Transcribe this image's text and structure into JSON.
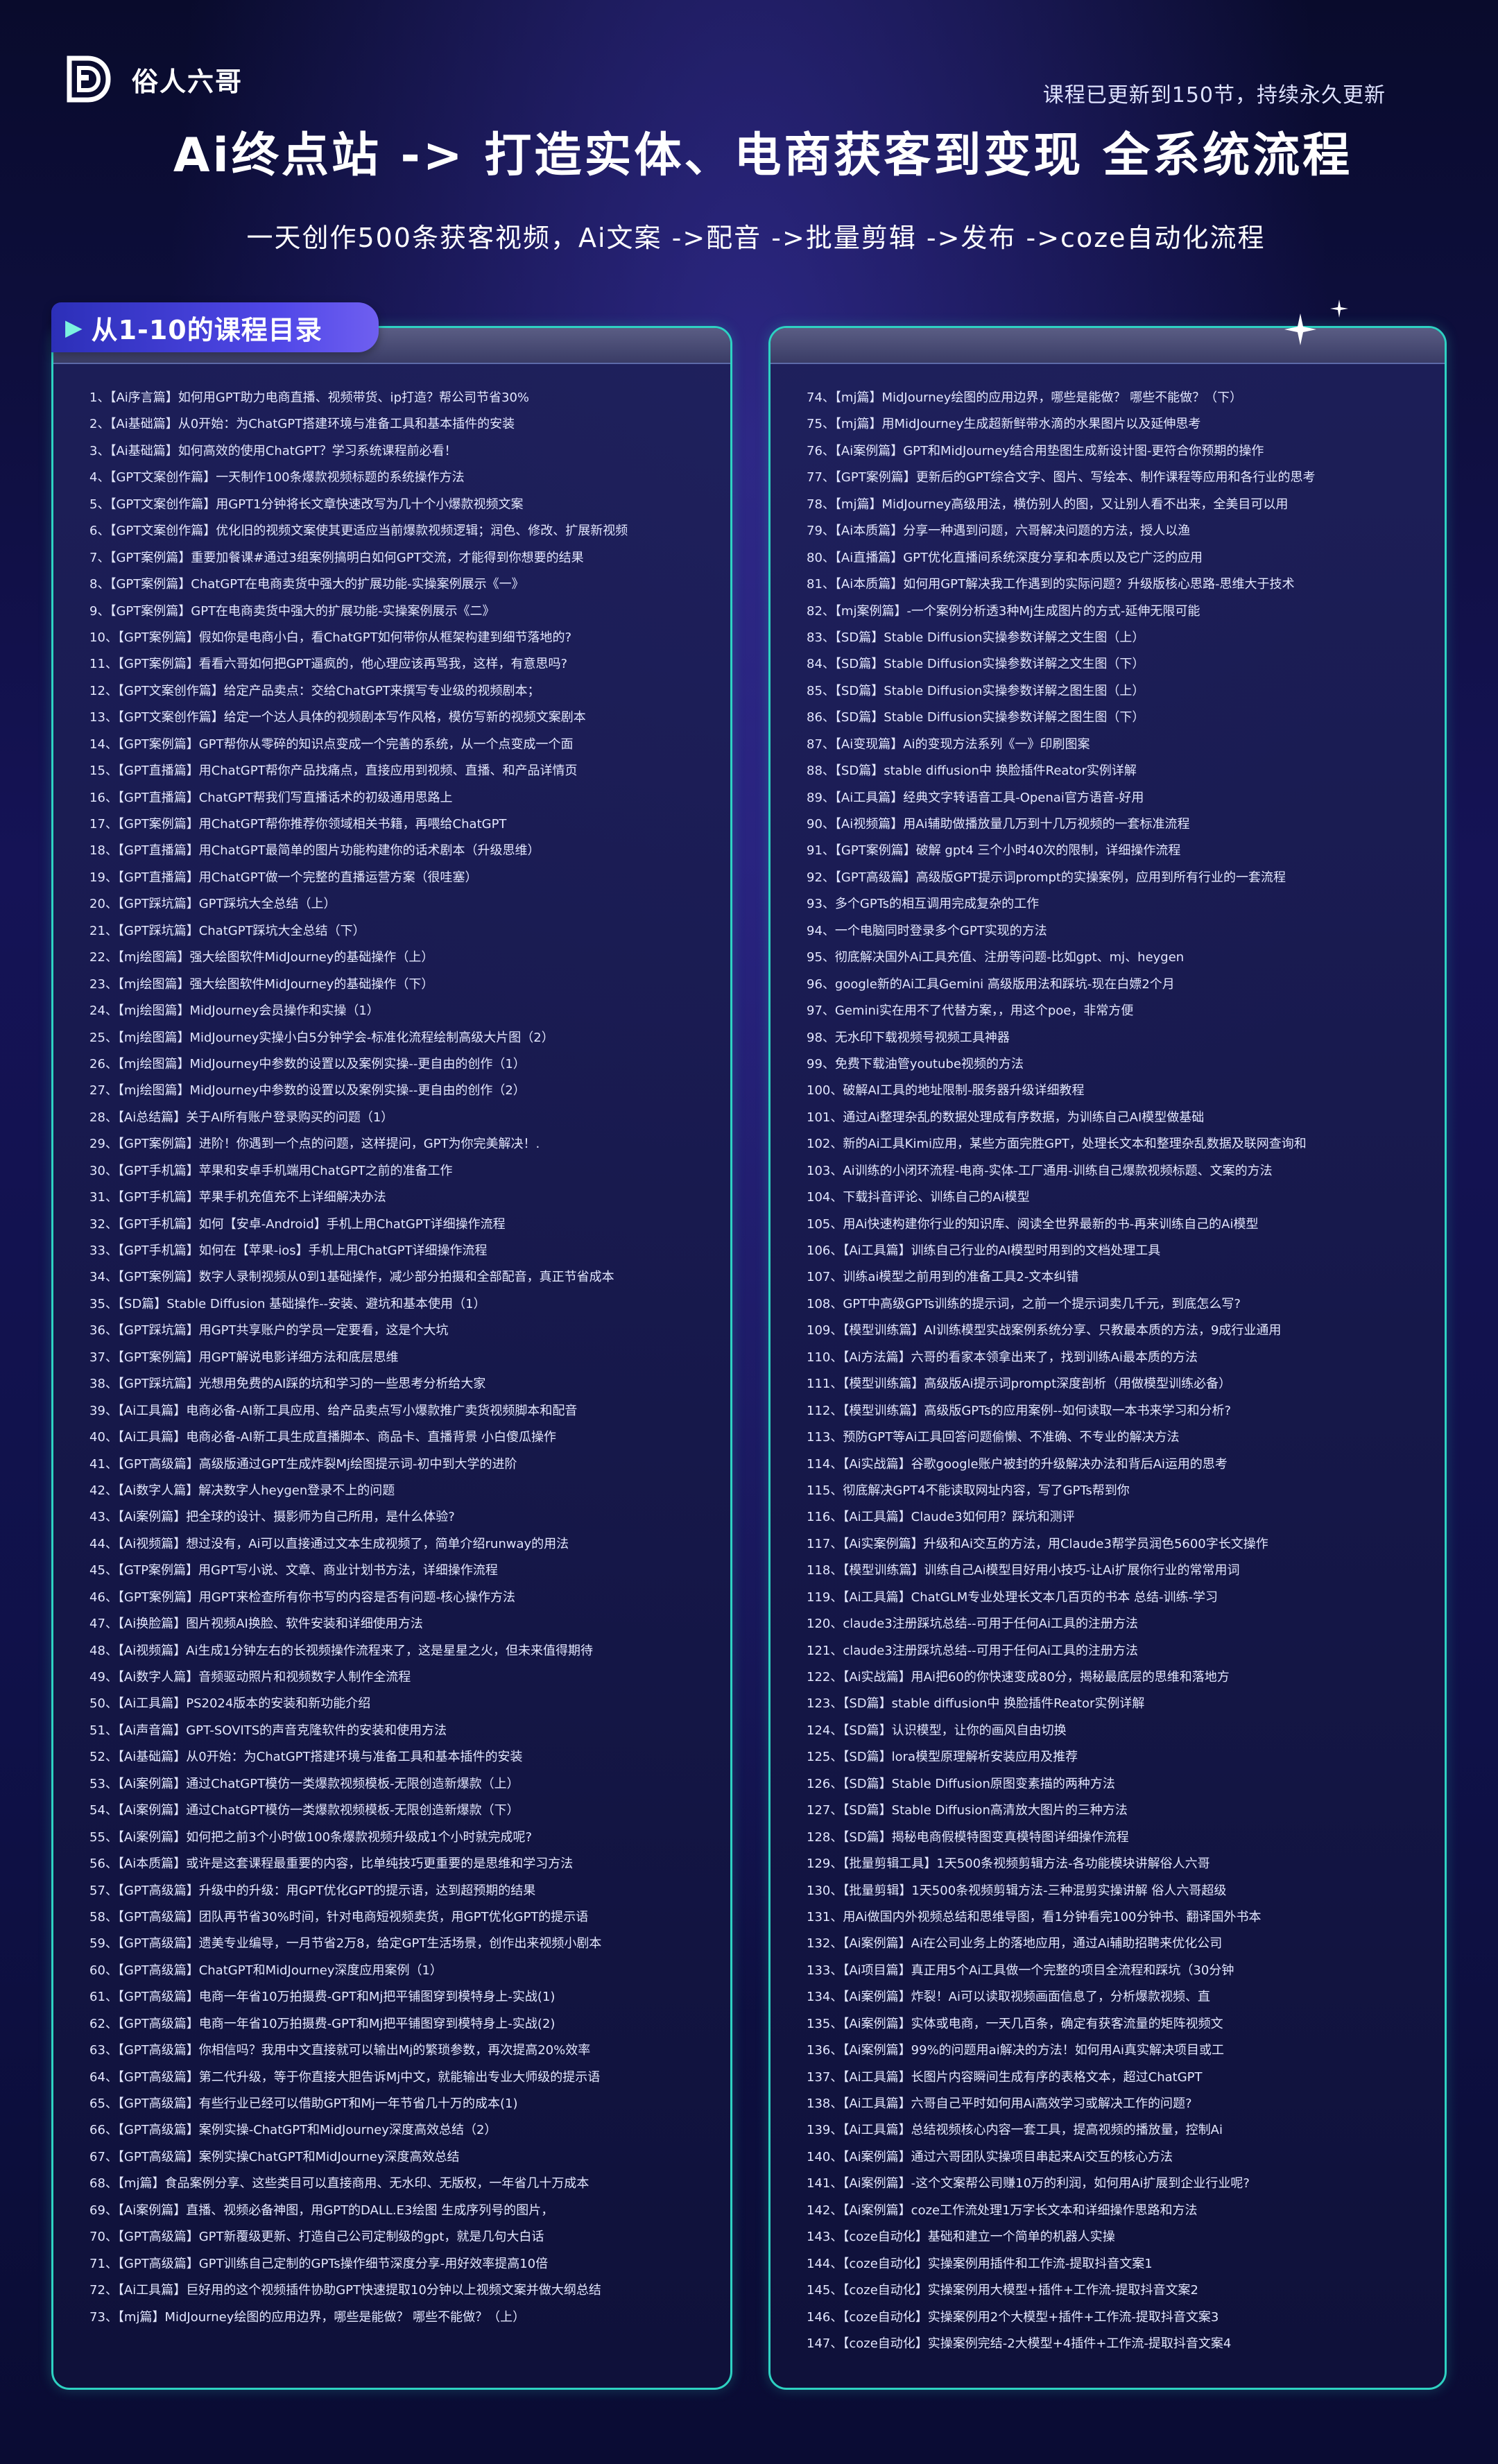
{
  "brand": {
    "name": "俗人六哥"
  },
  "header": {
    "update_note": "课程已更新到150节，持续永久更新",
    "title": "Ai终点站 -> 打造实体、电商获客到变现 全系统流程",
    "subtitle": "一天创作500条获客视频，Ai文案 ->配音 ->批量剪辑 ->发布 ->coze自动化流程"
  },
  "catalog": {
    "label": "从1-10的课程目录",
    "left": [
      "1、【Ai序言篇】如何用GPT助力电商直播、视频带货、ip打造？帮公司节省30%",
      "2、【Ai基础篇】从0开始：为ChatGPT搭建环境与准备工具和基本插件的安装",
      "3、【Ai基础篇】如何高效的使用ChatGPT？学习系统课程前必看！",
      "4、【GPT文案创作篇】一天制作100条爆款视频标题的系统操作方法",
      "5、【GPT文案创作篇】用GPT1分钟将长文章快速改写为几十个小爆款视频文案",
      "6、【GPT文案创作篇】优化旧的视频文案使其更适应当前爆款视频逻辑；润色、修改、扩展新视频",
      "7、【GPT案例篇】重要加餐课#通过3组案例搞明白如何GPT交流，才能得到你想要的结果",
      "8、【GPT案例篇】ChatGPT在电商卖货中强大的扩展功能-实操案例展示《一》",
      "9、【GPT案例篇】GPT在电商卖货中强大的扩展功能-实操案例展示《二》",
      "10、【GPT案例篇】假如你是电商小白，看ChatGPT如何带你从框架构建到细节落地的?",
      "11、【GPT案例篇】看看六哥如何把GPT逼疯的，他心理应该再骂我，这样，有意思吗?",
      "12、【GPT文案创作篇】给定产品卖点：交给ChatGPT来撰写专业级的视频剧本；",
      "13、【GPT文案创作篇】给定一个达人具体的视频剧本写作风格，模仿写新的视频文案剧本",
      "14、【GPT案例篇】GPT帮你从零碎的知识点变成一个完善的系统，从一个点变成一个面",
      "15、【GPT直播篇】用ChatGPT帮你产品找痛点，直接应用到视频、直播、和产品详情页",
      "16、【GPT直播篇】ChatGPT帮我们写直播话术的初级通用思路上",
      "17、【GPT案例篇】用ChatGPT帮你推荐你领域相关书籍，再喂给ChatGPT",
      "18、【GPT直播篇】用ChatGPT最简单的图片功能构建你的话术剧本（升级思维）",
      "19、【GPT直播篇】用ChatGPT做一个完整的直播运营方案（很哇塞）",
      "20、【GPT踩坑篇】GPT踩坑大全总结（上）",
      "21、【GPT踩坑篇】ChatGPT踩坑大全总结（下）",
      "22、【mj绘图篇】强大绘图软件MidJourney的基础操作（上）",
      "23、【mj绘图篇】强大绘图软件MidJourney的基础操作（下）",
      "24、【mj绘图篇】MidJourney会员操作和实操（1）",
      "25、【mj绘图篇】MidJourney实操小白5分钟学会-标准化流程绘制高级大片图（2）",
      "26、【mj绘图篇】MidJourney中参数的设置以及案例实操--更自由的创作（1）",
      "27、【mj绘图篇】MidJourney中参数的设置以及案例实操--更自由的创作（2）",
      "28、【Ai总结篇】关于AI所有账户登录购买的问题（1）",
      "29、【GPT案例篇】进阶！你遇到一个点的问题，这样提问，GPT为你完美解决！.",
      "30、【GPT手机篇】苹果和安卓手机端用ChatGPT之前的准备工作",
      "31、【GPT手机篇】苹果手机充值充不上详细解决办法",
      "32、【GPT手机篇】如何【安卓-Android】手机上用ChatGPT详细操作流程",
      "33、【GPT手机篇】如何在【苹果-ios】手机上用ChatGPT详细操作流程",
      "34、【GPT案例篇】数字人录制视频从0到1基础操作，减少部分拍摄和全部配音，真正节省成本",
      "35、【SD篇】Stable Diffusion 基础操作--安装、避坑和基本使用（1）",
      "36、【GPT踩坑篇】用GPT共享账户的学员一定要看，这是个大坑",
      "37、【GPT案例篇】用GPT解说电影详细方法和底层思维",
      "38、【GPT踩坑篇】光想用免费的AI踩的坑和学习的一些思考分析给大家",
      "39、【Ai工具篇】电商必备-AI新工具应用、给产品卖点写小爆款推广卖货视频脚本和配音",
      "40、【Ai工具篇】电商必备-AI新工具生成直播脚本、商品卡、直播背景 小白傻瓜操作",
      "41、【GPT高级篇】高级版通过GPT生成炸裂Mj绘图提示词-初中到大学的进阶",
      "42、【Ai数字人篇】解决数字人heygen登录不上的问题",
      "43、【Ai案例篇】把全球的设计、摄影师为自己所用，是什么体验?",
      "44、【Ai视频篇】想过没有，Ai可以直接通过文本生成视频了，简单介绍runway的用法",
      "45、【GTP案例篇】用GPT写小说、文章、商业计划书方法，详细操作流程",
      "46、【GPT案例篇】用GPT来检查所有你书写的内容是否有问题-核心操作方法",
      "47、【Ai换脸篇】图片视频AI换脸、软件安装和详细使用方法",
      "48、【Ai视频篇】Ai生成1分钟左右的长视频操作流程来了，这是星星之火，但未来值得期待",
      "49、【Ai数字人篇】音频驱动照片和视频数字人制作全流程",
      "50、【Ai工具篇】PS2024版本的安装和新功能介绍",
      "51、【Ai声音篇】GPT-SOVITS的声音克隆软件的安装和使用方法",
      "52、【Ai基础篇】从0开始：为ChatGPT搭建环境与准备工具和基本插件的安装",
      "53、【Ai案例篇】通过ChatGPT模仿一类爆款视频模板-无限创造新爆款（上）",
      "54、【Ai案例篇】通过ChatGPT模仿一类爆款视频模板-无限创造新爆款（下）",
      "55、【Ai案例篇】如何把之前3个小时做100条爆款视频升级成1个小时就完成呢?",
      "56、【Ai本质篇】或许是这套课程最重要的内容，比单纯技巧更重要的是思维和学习方法",
      "57、【GPT高级篇】升级中的升级：用GPT优化GPT的提示语，达到超预期的结果",
      "58、【GPT高级篇】团队再节省30%时间，针对电商短视频卖货，用GPT优化GPT的提示语",
      "59、【GPT高级篇】遗美专业编导，一月节省2万8，给定GPT生活场景，创作出来视频小剧本",
      "60、【GPT高级篇】ChatGPT和MidJourney深度应用案例（1）",
      "61、【GPT高级篇】电商一年省10万拍摄费-GPT和Mj把平铺图穿到模特身上-实战(1)",
      "62、【GPT高级篇】电商一年省10万拍摄费-GPT和Mj把平铺图穿到模特身上-实战(2)",
      "63、【GPT高级篇】你相信吗？我用中文直接就可以输出Mj的繁琐参数，再次提高20%效率",
      "64、【GPT高级篇】第二代升级，等于你直接大胆告诉Mj中文，就能输出专业大师级的提示语",
      "65、【GPT高级篇】有些行业已经可以借助GPT和Mj一年节省几十万的成本(1)",
      "66、【GPT高级篇】案例实操-ChatGPT和MidJourney深度高效总结（2）",
      "67、【GPT高级篇】案例实操ChatGPT和MidJourney深度高效总结",
      "68、【mj篇】食品案例分享、这些类目可以直接商用、无水印、无版权，一年省几十万成本",
      "69、【Ai案例篇】直播、视频必备神图，用GPT的DALL.E3绘图 生成序列号的图片，",
      "70、【GPT高级篇】GPT新覆级更新、打造自己公司定制级的gpt，就是几句大白话",
      "71、【GPT高级篇】GPT训练自己定制的GPTs操作细节深度分享-用好效率提高10倍",
      "72、【Ai工具篇】巨好用的这个视频插件协助GPT快速提取10分钟以上视频文案并做大纲总结",
      "73、【mj篇】MidJourney绘图的应用边界，哪些是能做？ 哪些不能做？（上）"
    ],
    "right": [
      "74、【mj篇】MidJourney绘图的应用边界，哪些是能做？ 哪些不能做？（下）",
      "75、【mj篇】用MidJourney生成超新鲜带水滴的水果图片以及延伸思考",
      "76、【Ai案例篇】GPT和MidJourney结合用垫图生成新设计图-更符合你预期的操作",
      "77、【GPT案例篇】更新后的GPT综合文字、图片、写绘本、制作课程等应用和各行业的思考",
      "78、【mj篇】MidJourney高级用法，横仿别人的图，又让别人看不出来，全美目可以用",
      "79、【Ai本质篇】分享一种遇到问题，六哥解决问题的方法，授人以渔",
      "80、【Ai直播篇】GPT优化直播间系统深度分享和本质以及它广泛的应用",
      "81、【Ai本质篇】如何用GPT解决我工作遇到的实际问题？升级版核心思路-思维大于技术",
      "82、【mj案例篇】-一个案例分析透3种Mj生成图片的方式-延伸无限可能",
      "83、【SD篇】Stable Diffusion实操参数详解之文生图（上）",
      "84、【SD篇】Stable Diffusion实操参数详解之文生图（下）",
      "85、【SD篇】Stable Diffusion实操参数详解之图生图（上）",
      "86、【SD篇】Stable Diffusion实操参数详解之图生图（下）",
      "87、【Ai变现篇】Ai的变现方法系列《一》印刷图案",
      "88、【SD篇】stable diffusion中 换脸插件Reator实例详解",
      "89、【Ai工具篇】经典文字转语音工具-Openai官方语音-好用",
      "90、【Ai视频篇】用Ai辅助做播放量几万到十几万视频的一套标准流程",
      "91、【GPT案例篇】破解 gpt4 三个小时40次的限制，详细操作流程",
      "92、【GPT高级篇】高级版GPT提示词prompt的实操案例，应用到所有行业的一套流程",
      "93、多个GPTs的相互调用完成复杂的工作",
      "94、一个电脑同时登录多个GPT实现的方法",
      "95、彻底解决国外Ai工具充值、注册等问题-比如gpt、mj、heygen",
      "96、google新的Ai工具Gemini 高级版用法和踩坑-现在白嫖2个月",
      "97、Gemini实在用不了代替方案，，用这个poe，非常方便",
      "98、无水印下载视频号视频工具神器",
      "99、免费下载油管youtube视频的方法",
      "100、破解AI工具的地址限制-服务器升级详细教程",
      "101、通过Ai整理杂乱的数据处理成有序数据，为训练自己AI模型做基础",
      "102、新的Ai工具Kimi应用，某些方面完胜GPT，处理长文本和整理杂乱数据及联网查询和",
      "103、Ai训练的小闭环流程-电商-实体-工厂通用-训练自己爆款视频标题、文案的方法",
      "104、下载抖音评论、训练自己的Ai模型",
      "105、用Ai快速构建你行业的知识库、阅读全世界最新的书-再来训练自己的Ai模型",
      "106、【Ai工具篇】训练自己行业的AI模型时用到的文档处理工具",
      "107、训练ai模型之前用到的准备工具2-文本纠错",
      "108、GPT中高级GPTs训练的提示词，之前一个提示词卖几千元，到底怎么写?",
      "109、【模型训练篇】AI训练模型实战案例系统分享、只教最本质的方法，9成行业通用",
      "110、【Ai方法篇】六哥的看家本领拿出来了，找到训练Ai最本质的方法",
      "111、【模型训练篇】高级版Ai提示词prompt深度剖析（用做模型训练必备）",
      "112、【模型训练篇】高级版GPTs的应用案例--如何读取一本书来学习和分析?",
      "113、预防GPT等Ai工具回答问题偷懒、不准确、不专业的解决方法",
      "114、【Ai实战篇】谷歌google账户被封的升级解决办法和背后Ai运用的思考",
      "115、彻底解决GPT4不能读取网址内容，写了GPTs帮到你",
      "116、【Ai工具篇】Claude3如何用？踩坑和测评",
      "117、【Ai实案例篇】升级和Ai交互的方法，用Claude3帮学员润色5600字长文操作",
      "118、【模型训练篇】训练自己Ai模型目好用小技巧-让Ai扩展你行业的常常用词",
      "119、【Ai工具篇】ChatGLM专业处理长文本几百页的书本 总结-训练-学习",
      "120、claude3注册踩坑总结--可用于任何Ai工具的注册方法",
      "121、claude3注册踩坑总结--可用于任何Ai工具的注册方法",
      "122、【Ai实战篇】用Ai把60的你快速变成80分，揭秘最底层的思维和落地方",
      "123、【SD篇】stable diffusion中 换脸插件Reator实例详解",
      "124、【SD篇】认识模型，让你的画风自由切换",
      "125、【SD篇】lora模型原理解析安装应用及推荐",
      "126、【SD篇】Stable Diffusion原图变素描的两种方法",
      "127、【SD篇】Stable Diffusion高清放大图片的三种方法",
      "128、【SD篇】揭秘电商假模特图变真模特图详细操作流程",
      "129、【批量剪辑工具】1天500条视频剪辑方法-各功能模块讲解俗人六哥",
      "130、【批量剪辑】1天500条视频剪辑方法-三种混剪实操讲解 俗人六哥超级",
      "131、用Ai做国内外视频总结和思维导图，看1分钟看完100分钟书、翻译国外书本",
      "132、【Ai案例篇】Ai在公司业务上的落地应用，通过Ai辅助招聘来优化公司",
      "133、【Ai项目篇】真正用5个Ai工具做一个完整的项目全流程和踩坑（30分钟",
      "134、【Ai案例篇】炸裂！Ai可以读取视频画面信息了，分析爆款视频、直",
      "135、【Ai案例篇】实体或电商，一天几百条，确定有获客流量的矩阵视频文",
      "136、【Ai案例篇】99%的问题用ai解决的方法！如何用Ai真实解决项目或工",
      "137、【Ai工具篇】长图片内容瞬间生成有序的表格文本，超过ChatGPT",
      "138、【Ai工具篇】六哥自己平时如何用Ai高效学习或解决工作的问题?",
      "139、【Ai工具篇】总结视频核心内容一套工具，提高视频的播放量，控制Ai",
      "140、【Ai案例篇】通过六哥团队实操项目串起来Ai交互的核心方法",
      "141、【Ai案例篇】-这个文案帮公司赚10万的利润，如何用Ai扩展到企业行业呢?",
      "142、【Ai案例篇】coze工作流处理1万字长文本和详细操作思路和方法",
      "143、【coze自动化】基础和建立一个简单的机器人实操",
      "144、【coze自动化】实操案例用插件和工作流-提取抖音文案1",
      "145、【coze自动化】实操案例用大模型+插件+工作流-提取抖音文案2",
      "146、【coze自动化】实操案例用2个大模型+插件+工作流-提取抖音文案3",
      "147、【coze自动化】实操案例完结-2大模型+4插件+工作流-提取抖音文案4"
    ]
  }
}
